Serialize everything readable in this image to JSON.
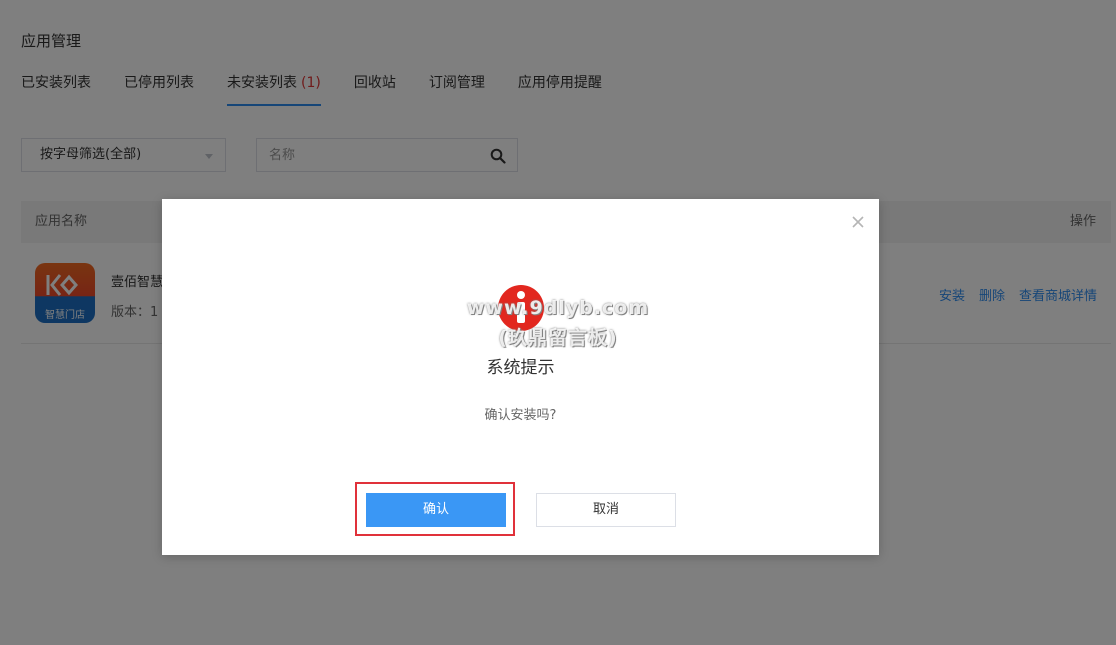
{
  "page": {
    "title": "应用管理"
  },
  "tabs": [
    {
      "label": "已安装列表",
      "count": ""
    },
    {
      "label": "已停用列表",
      "count": ""
    },
    {
      "label": "未安装列表",
      "count": "(1)"
    },
    {
      "label": "回收站",
      "count": ""
    },
    {
      "label": "订阅管理",
      "count": ""
    },
    {
      "label": "应用停用提醒",
      "count": ""
    }
  ],
  "active_tab": 2,
  "filters": {
    "letter_filter": "按字母筛选(全部)",
    "search_placeholder": "名称",
    "search_value": ""
  },
  "table": {
    "col_name": "应用名称",
    "col_ops": "操作",
    "rows": [
      {
        "name": "壹佰智慧",
        "version": "版本：1",
        "logo_text": "智慧门店",
        "ops": [
          "安装",
          "删除",
          "查看商城详情"
        ]
      }
    ]
  },
  "dialog": {
    "title": "系统提示",
    "message": "确认安装吗?",
    "confirm_label": "确认",
    "cancel_label": "取消",
    "watermark_line1": "www.9dlyb.com",
    "watermark_line2": "(玖鼎留言板)"
  },
  "colors": {
    "accent": "#2d8cf0",
    "confirm_button": "#3a97f5",
    "info_icon": "#e2271f",
    "highlight_border": "#e0313a",
    "tab_count": "#e03636"
  },
  "icons": {
    "search": "search-icon",
    "close": "close-icon",
    "info": "info-icon",
    "caret": "chevron-down-icon"
  }
}
